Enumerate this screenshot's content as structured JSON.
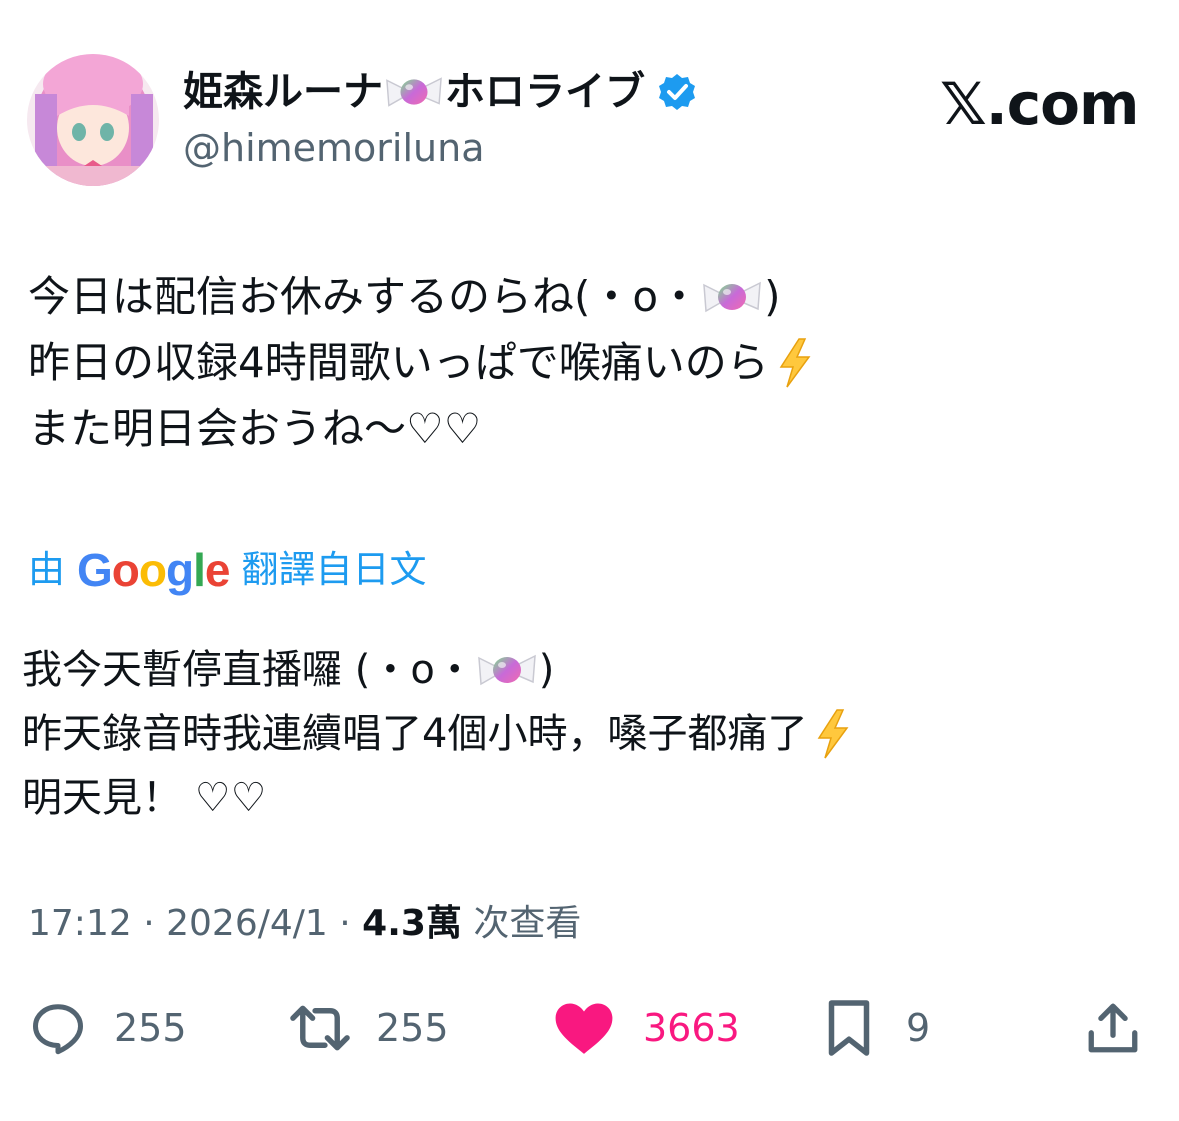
{
  "account": {
    "display_name_part1": "姫森ルーナ",
    "display_name_part2": "ホロライブ",
    "handle": "@himemoriluna",
    "verified": true,
    "avatar_icon": "avatar-pink-hair-character"
  },
  "brand": "𝕏.com",
  "tweet": {
    "line1": "今日は配信お休みするのらね(・o・",
    "line1_end": ")",
    "line2": "昨日の収録4時間歌いっぱで喉痛いのら",
    "line3": "また明日会おうね〜♡♡"
  },
  "translation": {
    "prefix": "由",
    "google": "Google",
    "suffix": "翻譯自日文",
    "line1": "我今天暫停直播囉 (・o・",
    "line1_end": ")",
    "line2": "昨天錄音時我連續唱了4個小時，嗓子都痛了",
    "line3": "明天見！ ♡♡"
  },
  "meta": {
    "time": "17:12",
    "date": "2026/4/1",
    "views": "4.3萬",
    "views_label": "次查看",
    "sep": "·"
  },
  "actions": {
    "replies": "255",
    "reposts": "255",
    "likes": "3663",
    "bookmarks": "9"
  },
  "colors": {
    "link_blue": "#1d9bf0",
    "like_pink": "#f91880",
    "muted": "#536471",
    "text": "#0f1419"
  },
  "icons": [
    "candy-emoji",
    "verified-badge-icon",
    "lightning-emoji",
    "reply-icon",
    "repost-icon",
    "heart-icon",
    "bookmark-icon",
    "share-icon"
  ]
}
